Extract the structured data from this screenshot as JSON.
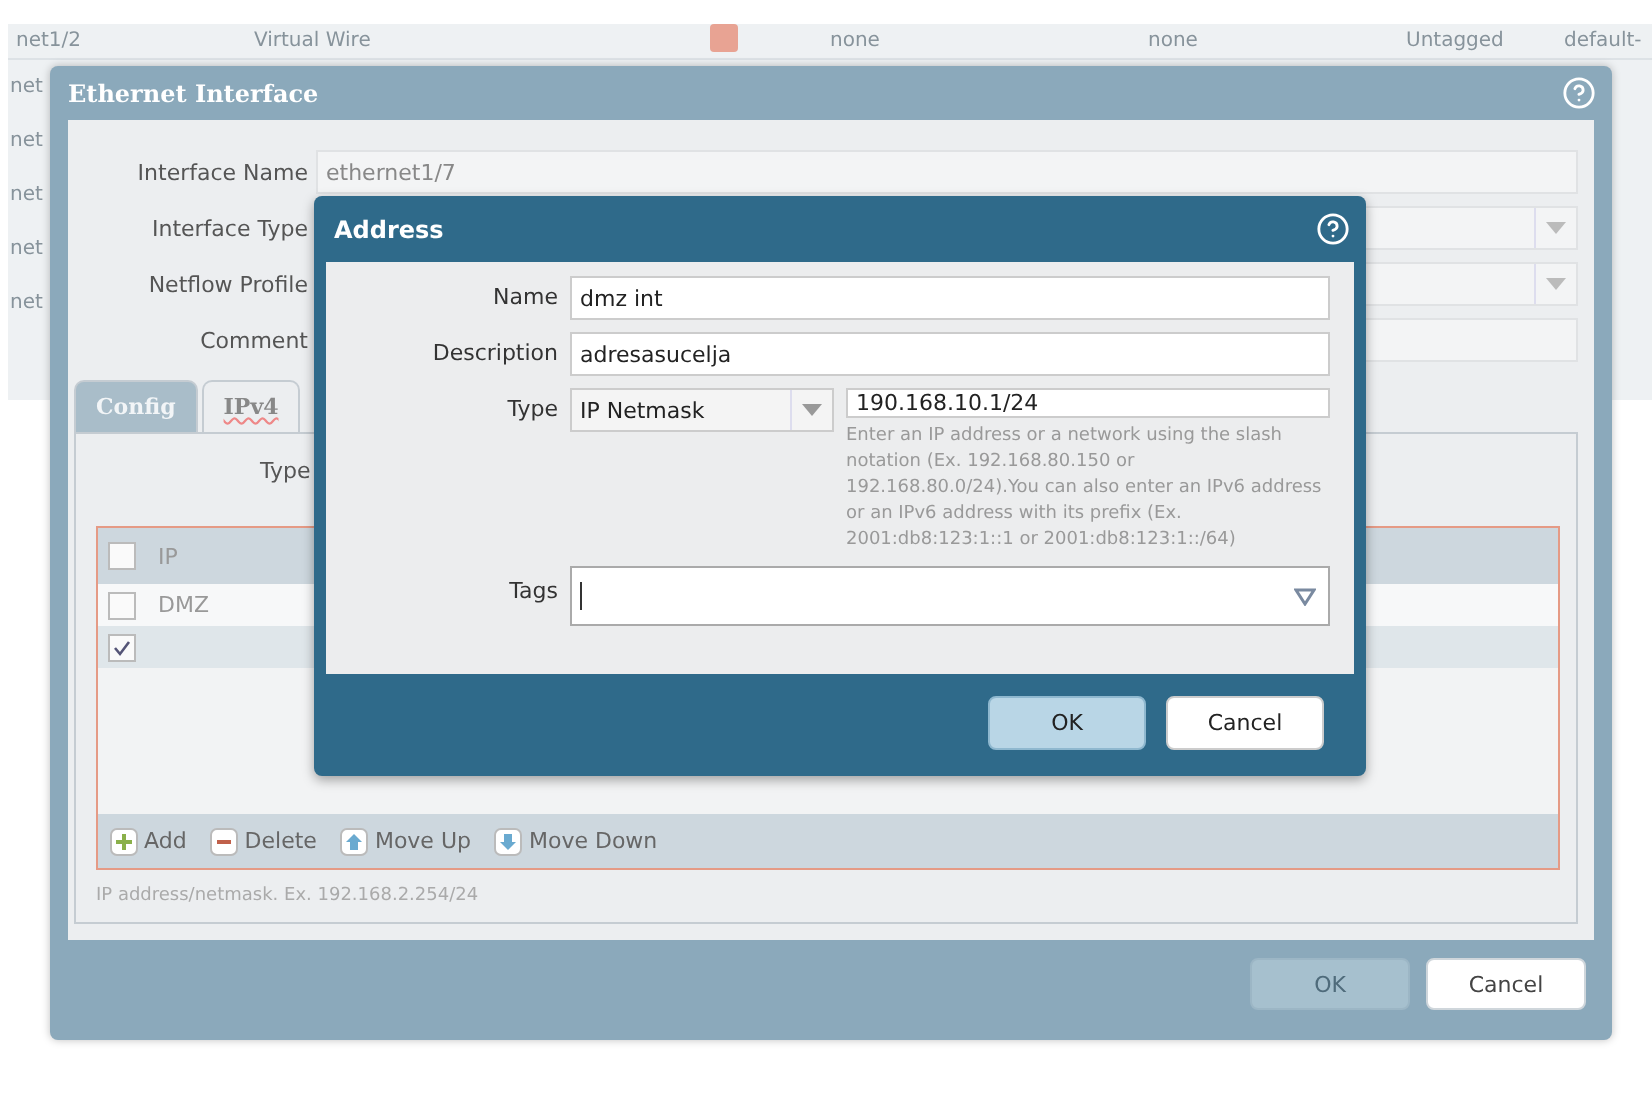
{
  "background_table": {
    "row": {
      "interface": "net1/2",
      "type": "Virtual Wire",
      "column_3": "none",
      "column_4": "none",
      "column_5": "Untagged",
      "column_6": "default-"
    },
    "fragments": [
      "net",
      "net",
      "net",
      "net",
      "net"
    ]
  },
  "ethernet_dialog": {
    "title": "Ethernet Interface",
    "fields": [
      {
        "label": "Interface Name",
        "value": "ethernet1/7",
        "kind": "text"
      },
      {
        "label": "Interface Type",
        "kind": "select"
      },
      {
        "label": "Netflow Profile",
        "kind": "select"
      },
      {
        "label": "Comment",
        "kind": "text"
      }
    ],
    "tabs": [
      {
        "label": "Config",
        "selected": false
      },
      {
        "label": "IPv4",
        "selected": true
      }
    ],
    "type_label": "Type",
    "table": {
      "header": "IP",
      "header_checked": false,
      "rows": [
        {
          "ip": "DMZ",
          "checked": false,
          "selected": false
        },
        {
          "checked": true,
          "selected": true
        }
      ]
    },
    "toolbar": [
      {
        "label": "Add",
        "kind": "add"
      },
      {
        "label": "Delete",
        "kind": "delete"
      },
      {
        "label": "Move Up",
        "kind": "up"
      },
      {
        "label": "Move Down",
        "kind": "down"
      }
    ],
    "hint": "IP address/netmask. Ex. 192.168.2.254/24",
    "buttons": [
      {
        "label": "OK",
        "disabled": true
      },
      {
        "label": "Cancel",
        "disabled": false
      }
    ]
  },
  "address_dialog": {
    "title": "Address",
    "name": {
      "label": "Name",
      "value": "dmz int"
    },
    "description": {
      "label": "Description",
      "value": "adresasucelja"
    },
    "type": {
      "label": "Type",
      "selected": "IP Netmask",
      "value": "190.168.10.1/24",
      "help": "Enter an IP address or a network using the slash notation (Ex. 192.168.80.150 or 192.168.80.0/24).You can also enter an IPv6 address or an IPv6 address with its prefix (Ex. 2001:db8:123:1::1 or 2001:db8:123:1::/64)"
    },
    "tags": {
      "label": "Tags"
    },
    "buttons": [
      {
        "label": "OK",
        "default": true
      },
      {
        "label": "Cancel",
        "default": false
      }
    ]
  }
}
